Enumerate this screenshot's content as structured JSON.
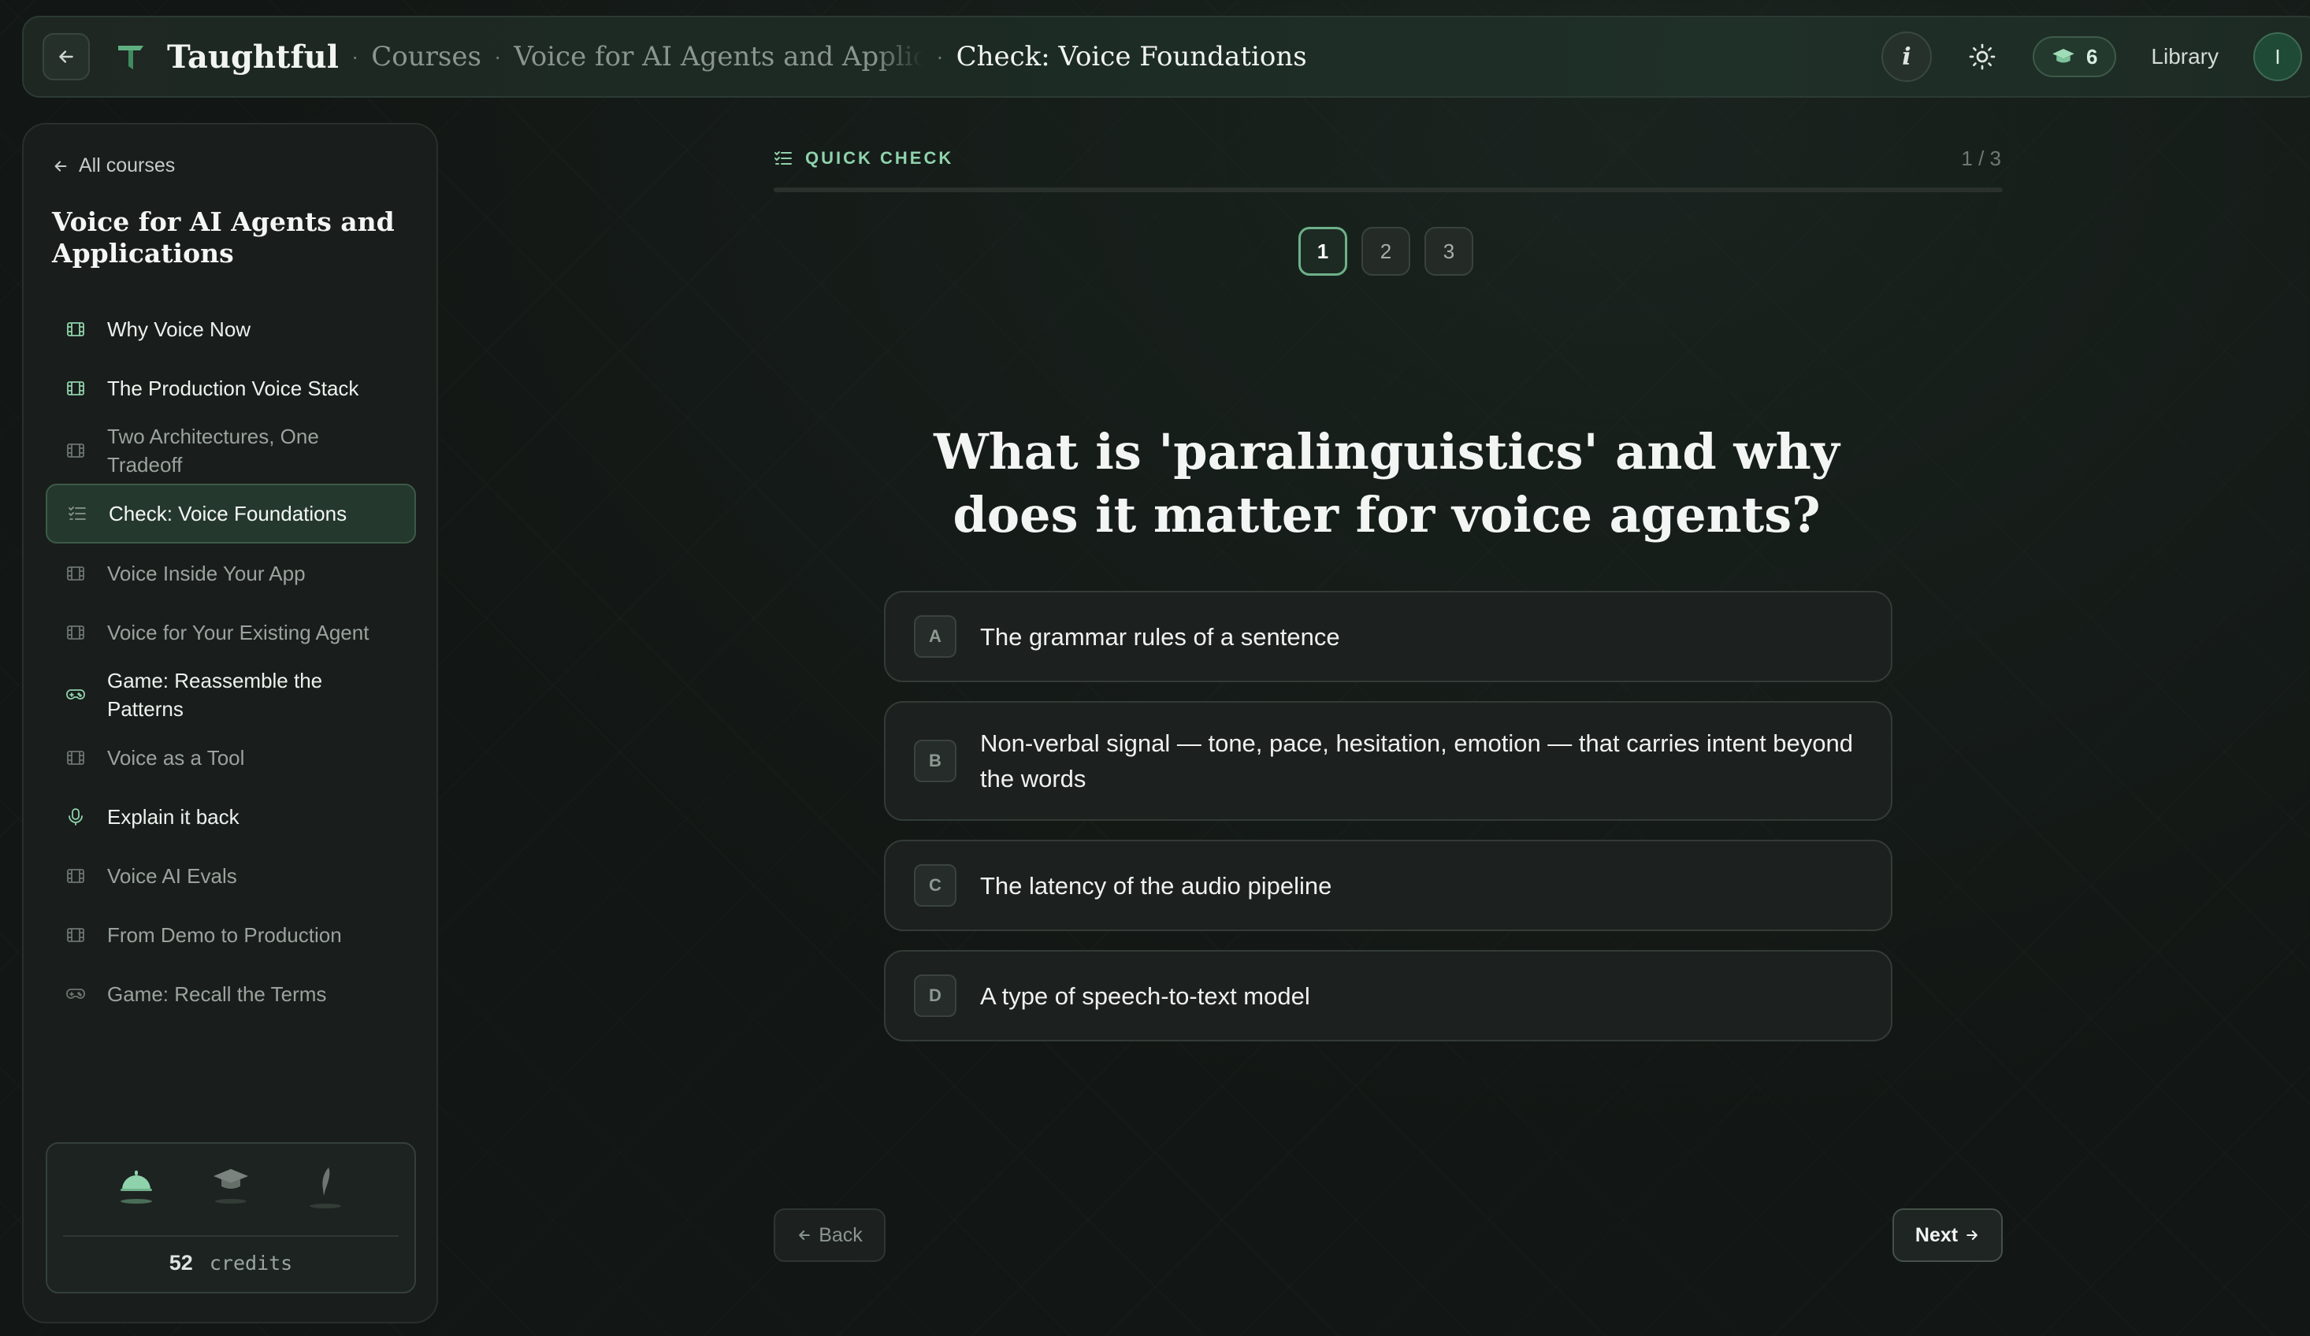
{
  "header": {
    "brand": "Taughtful",
    "breadcrumbs": [
      "Courses",
      "Voice for AI Agents and Applications",
      "Check: Voice Foundations"
    ],
    "xp_count": "6",
    "library_label": "Library",
    "avatar_initial": "I",
    "info_glyph": "i",
    "accent_color": "#6fb08a"
  },
  "sidebar": {
    "back_label": "All courses",
    "course_title": "Voice for AI Agents and Applications",
    "lessons": [
      {
        "label": "Why Voice Now",
        "icon": "film-icon",
        "state": "bright"
      },
      {
        "label": "The Production Voice Stack",
        "icon": "film-icon",
        "state": "bright"
      },
      {
        "label": "Two Architectures, One Tradeoff",
        "icon": "film-icon",
        "state": "dim"
      },
      {
        "label": "Check: Voice Foundations",
        "icon": "checklist-icon",
        "state": "active"
      },
      {
        "label": "Voice Inside Your App",
        "icon": "film-icon",
        "state": "dim"
      },
      {
        "label": "Voice for Your Existing Agent",
        "icon": "film-icon",
        "state": "dim"
      },
      {
        "label": "Game: Reassemble the Patterns",
        "icon": "gamepad-icon",
        "state": "bright"
      },
      {
        "label": "Voice as a Tool",
        "icon": "film-icon",
        "state": "dim"
      },
      {
        "label": "Explain it back",
        "icon": "microphone-icon",
        "state": "bright"
      },
      {
        "label": "Voice AI Evals",
        "icon": "film-icon",
        "state": "dim"
      },
      {
        "label": "From Demo to Production",
        "icon": "film-icon",
        "state": "dim"
      },
      {
        "label": "Game: Recall the Terms",
        "icon": "gamepad-icon",
        "state": "dim"
      }
    ],
    "credits": {
      "amount": "52",
      "unit": "credits",
      "badges": [
        "bell-icon",
        "graduation-cap-icon",
        "quill-icon"
      ]
    }
  },
  "quiz": {
    "section_label": "QUICK CHECK",
    "current": 1,
    "total": 3,
    "counter": "1 / 3",
    "progress_fraction": 0.0,
    "steps": [
      "1",
      "2",
      "3"
    ],
    "question": "What is 'paralinguistics' and why does it matter for voice agents?",
    "options": [
      {
        "letter": "A",
        "text": "The grammar rules of a sentence"
      },
      {
        "letter": "B",
        "text": "Non-verbal signal — tone, pace, hesitation, emotion — that carries intent beyond the words"
      },
      {
        "letter": "C",
        "text": "The latency of the audio pipeline"
      },
      {
        "letter": "D",
        "text": "A type of speech-to-text model"
      }
    ],
    "back_label": "Back",
    "next_label": "Next"
  }
}
